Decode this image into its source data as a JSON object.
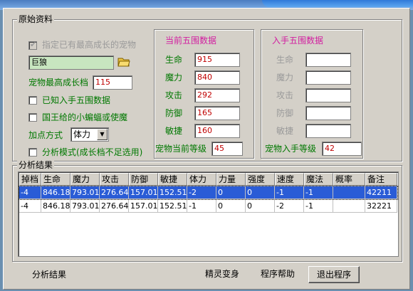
{
  "orig": {
    "legend": "原始资料",
    "max_growth_check": "指定已有最高成长的宠物",
    "pet_name": "巨狼",
    "max_growth_label": "宠物最高成长档",
    "max_growth_value": "115",
    "known_stats_label": "已知入手五围数据",
    "king_bat_label": "国王给的小蝙蝠或使魔",
    "bonus_label": "加点方式",
    "bonus_value": "体力",
    "analysis_mode_label": "分析模式(成长档不足选用)"
  },
  "current": {
    "title": "当前五围数据",
    "fields": [
      {
        "label": "生命",
        "value": "915"
      },
      {
        "label": "魔力",
        "value": "840"
      },
      {
        "label": "攻击",
        "value": "292"
      },
      {
        "label": "防御",
        "value": "165"
      },
      {
        "label": "敏捷",
        "value": "160"
      }
    ],
    "level_label": "宠物当前等级",
    "level_value": "45"
  },
  "acquired": {
    "title": "入手五围数据",
    "fields": [
      {
        "label": "生命",
        "value": ""
      },
      {
        "label": "魔力",
        "value": ""
      },
      {
        "label": "攻击",
        "value": ""
      },
      {
        "label": "防御",
        "value": ""
      },
      {
        "label": "敏捷",
        "value": ""
      }
    ],
    "level_label": "宠物入手等级",
    "level_value": "42"
  },
  "analysis": {
    "legend": "分析结果",
    "columns": [
      "掉档",
      "生命",
      "魔力",
      "攻击",
      "防御",
      "敏捷",
      "体力",
      "力量",
      "强度",
      "速度",
      "魔法",
      "概率",
      "备注"
    ],
    "rows": [
      [
        "-4",
        "846.18",
        "793.01",
        "276.64",
        "157.01",
        "152.51",
        "-2",
        "0",
        "0",
        "-1",
        "-1",
        "",
        "42211"
      ],
      [
        "-4",
        "846.18",
        "793.01",
        "276.64",
        "157.01",
        "152.51",
        "-1",
        "0",
        "0",
        "-2",
        "-1",
        "",
        "32221"
      ]
    ],
    "selected_row": 0
  },
  "bottom": {
    "status": "分析结果",
    "spirit_button": "精灵变身",
    "help_button": "程序帮助",
    "exit_button": "退出程序"
  },
  "colors": {
    "green_label": "#007800",
    "magenta_title": "#d21ea0",
    "value_red": "#c00000",
    "selection": "#2a5cd6",
    "window_bg": "#d4d0c8"
  },
  "icons": {
    "open_folder": "folder-open-icon",
    "dropdown": "chevron-down-icon",
    "checkmark": "check-icon"
  }
}
